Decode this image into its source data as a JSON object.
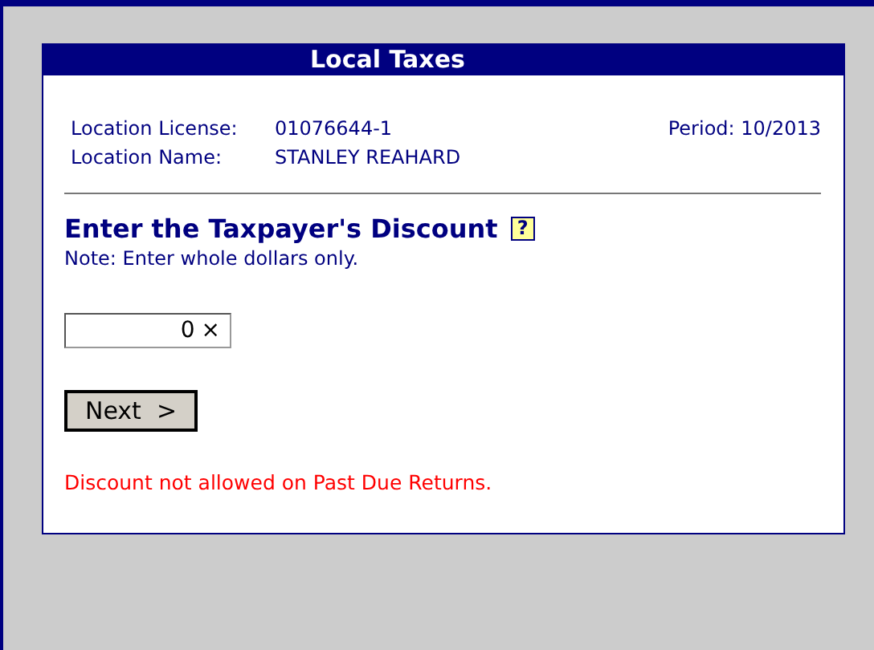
{
  "panel": {
    "title": "Local Taxes"
  },
  "info": [
    {
      "label": "Location License:",
      "value": "01076644-1"
    },
    {
      "label": "Location Name:",
      "value": "STANLEY REAHARD"
    }
  ],
  "period": "Period: 10/2013",
  "heading": "Enter the Taxpayer's Discount",
  "help_symbol": "?",
  "note": "Note: Enter whole dollars only.",
  "discount_field": {
    "value": "0",
    "clear_symbol": "×"
  },
  "next_button": "Next  >",
  "error": "Discount not allowed on Past Due Returns."
}
